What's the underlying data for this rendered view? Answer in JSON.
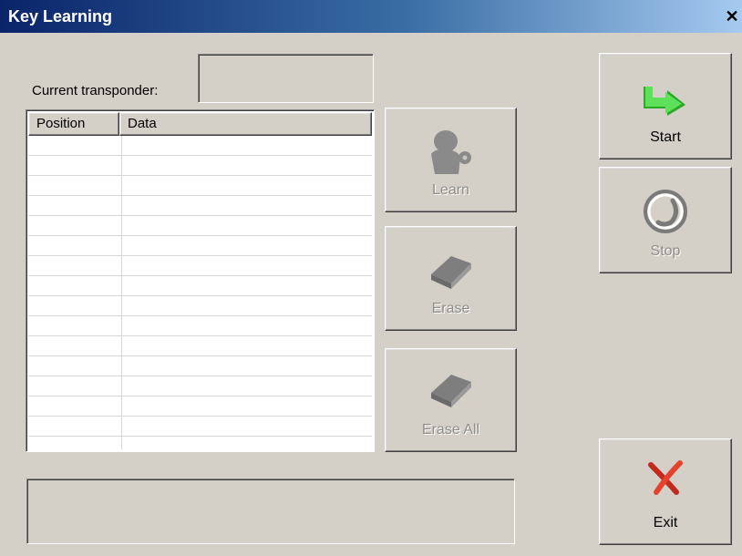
{
  "window": {
    "title": "Key Learning",
    "close_glyph": "✕"
  },
  "transponder": {
    "label": "Current transponder:",
    "value": ""
  },
  "table": {
    "columns": [
      "Position",
      "Data"
    ],
    "row_count": 16
  },
  "buttons": {
    "learn": {
      "label": "Learn",
      "icon": "learn-person-key-icon",
      "enabled": false
    },
    "erase": {
      "label": "Erase",
      "icon": "eraser-icon",
      "enabled": false
    },
    "erase_all": {
      "label": "Erase All",
      "icon": "eraser-icon",
      "enabled": false
    },
    "start": {
      "label": "Start",
      "icon": "green-arrow-right-icon",
      "enabled": true
    },
    "stop": {
      "label": "Stop",
      "icon": "circular-stop-icon",
      "enabled": false
    },
    "exit": {
      "label": "Exit",
      "icon": "red-x-icon",
      "enabled": true
    }
  },
  "status_bar": {
    "text": ""
  },
  "colors": {
    "face": "#d4d0c8",
    "title_start": "#0a246a",
    "title_end": "#a6caf0",
    "start_green": "#3ac83a",
    "exit_red": "#e03020",
    "disabled": "#8f8d88"
  }
}
